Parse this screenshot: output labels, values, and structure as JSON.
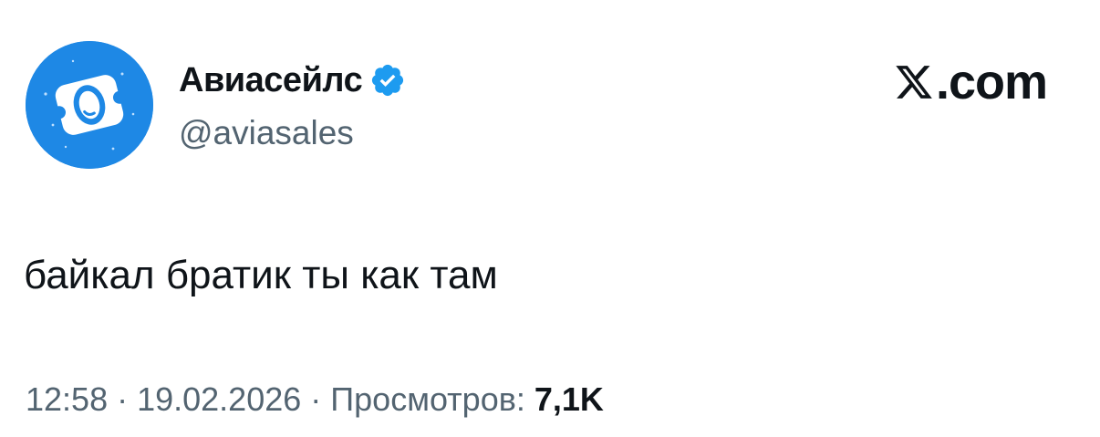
{
  "author": {
    "display_name": "Авиасейлс",
    "handle": "@aviasales",
    "verified": true,
    "avatar_color": "#1e88e5",
    "verified_color": "#1d9bf0"
  },
  "brand": {
    "domain_suffix": ".com",
    "icon": "x-logo-icon"
  },
  "tweet": {
    "text": "байкал братик ты как там"
  },
  "meta": {
    "time": "12:58",
    "separator": "·",
    "date": "19.02.2026",
    "views_label": "Просмотров:",
    "views_count": "7,1K"
  }
}
